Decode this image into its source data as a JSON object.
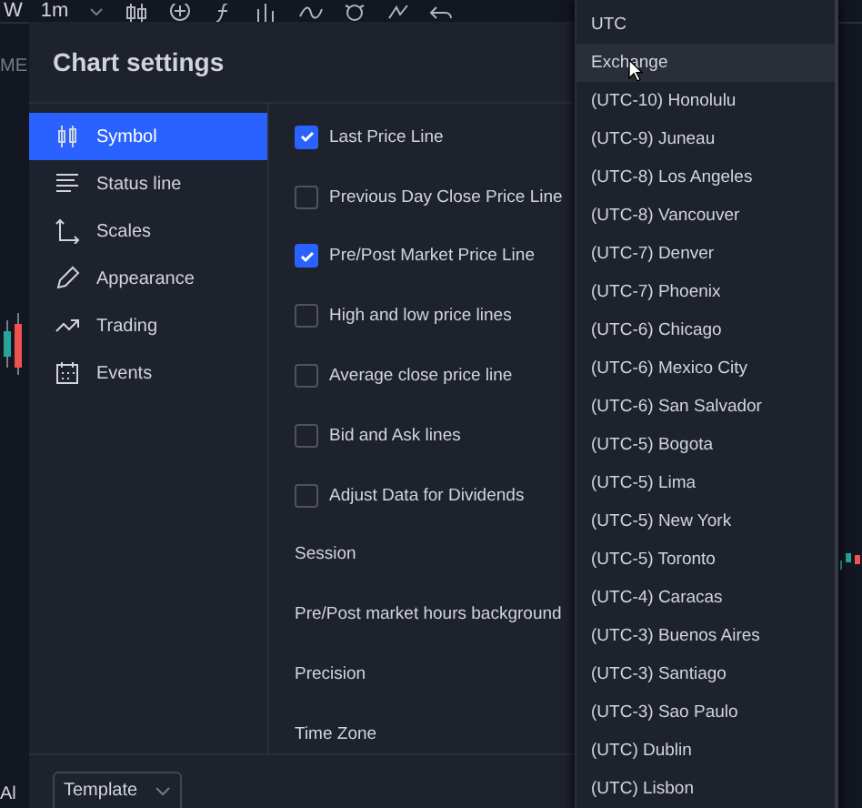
{
  "toolbar": {
    "texts": [
      "W",
      "1m"
    ]
  },
  "edge_texts": {
    "top": "ME",
    "bottom": "Al"
  },
  "dialog": {
    "title": "Chart settings",
    "sidebar": [
      {
        "label": "Symbol",
        "selected": true
      },
      {
        "label": "Status line",
        "selected": false
      },
      {
        "label": "Scales",
        "selected": false
      },
      {
        "label": "Appearance",
        "selected": false
      },
      {
        "label": "Trading",
        "selected": false
      },
      {
        "label": "Events",
        "selected": false
      }
    ],
    "options": [
      {
        "kind": "check",
        "label": "Last Price Line",
        "checked": true
      },
      {
        "kind": "check",
        "label": "Previous Day Close Price Line",
        "checked": false
      },
      {
        "kind": "check",
        "label": "Pre/Post Market Price Line",
        "checked": true
      },
      {
        "kind": "check",
        "label": "High and low price lines",
        "checked": false
      },
      {
        "kind": "check",
        "label": "Average close price line",
        "checked": false
      },
      {
        "kind": "check",
        "label": "Bid and Ask lines",
        "checked": false
      },
      {
        "kind": "check",
        "label": "Adjust Data for Dividends",
        "checked": false
      },
      {
        "kind": "label",
        "label": "Session"
      },
      {
        "kind": "label",
        "label": "Pre/Post market hours background"
      },
      {
        "kind": "label",
        "label": "Precision"
      },
      {
        "kind": "label",
        "label": "Time Zone"
      }
    ],
    "template_button": "Template"
  },
  "timezone_menu": {
    "items": [
      {
        "label": "UTC",
        "hovered": false
      },
      {
        "label": "Exchange",
        "hovered": true
      },
      {
        "label": "(UTC-10) Honolulu",
        "hovered": false
      },
      {
        "label": "(UTC-9) Juneau",
        "hovered": false
      },
      {
        "label": "(UTC-8) Los Angeles",
        "hovered": false
      },
      {
        "label": "(UTC-8) Vancouver",
        "hovered": false
      },
      {
        "label": "(UTC-7) Denver",
        "hovered": false
      },
      {
        "label": "(UTC-7) Phoenix",
        "hovered": false
      },
      {
        "label": "(UTC-6) Chicago",
        "hovered": false
      },
      {
        "label": "(UTC-6) Mexico City",
        "hovered": false
      },
      {
        "label": "(UTC-6) San Salvador",
        "hovered": false
      },
      {
        "label": "(UTC-5) Bogota",
        "hovered": false
      },
      {
        "label": "(UTC-5) Lima",
        "hovered": false
      },
      {
        "label": "(UTC-5) New York",
        "hovered": false
      },
      {
        "label": "(UTC-5) Toronto",
        "hovered": false
      },
      {
        "label": "(UTC-4) Caracas",
        "hovered": false
      },
      {
        "label": "(UTC-3) Buenos Aires",
        "hovered": false
      },
      {
        "label": "(UTC-3) Santiago",
        "hovered": false
      },
      {
        "label": "(UTC-3) Sao Paulo",
        "hovered": false
      },
      {
        "label": "(UTC) Dublin",
        "hovered": false
      },
      {
        "label": "(UTC) Lisbon",
        "hovered": false
      }
    ]
  }
}
